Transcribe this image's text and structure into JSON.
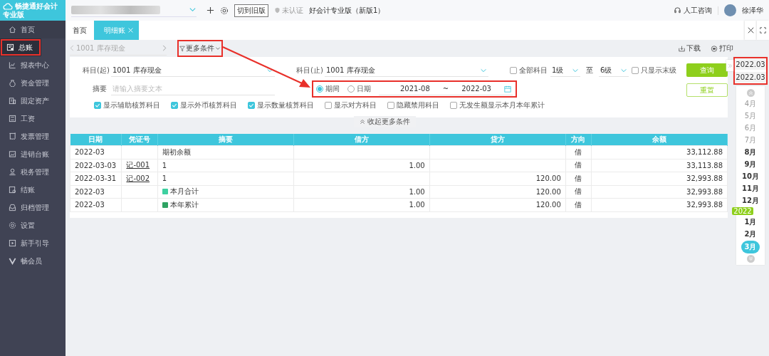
{
  "sidebar": {
    "logo": {
      "title": "畅捷通好会计",
      "edition": "专业版"
    },
    "items": [
      {
        "label": "首页",
        "selected": false,
        "highlighted": false
      },
      {
        "label": "总账",
        "selected": true,
        "highlighted": true
      },
      {
        "label": "报表中心",
        "selected": false,
        "highlighted": false
      },
      {
        "label": "资金管理",
        "selected": false,
        "highlighted": false
      },
      {
        "label": "固定资产",
        "selected": false,
        "highlighted": false
      },
      {
        "label": "工资",
        "selected": false,
        "highlighted": false
      },
      {
        "label": "发票管理",
        "selected": false,
        "highlighted": false
      },
      {
        "label": "进销台账",
        "selected": false,
        "highlighted": false
      },
      {
        "label": "税务管理",
        "selected": false,
        "highlighted": false
      },
      {
        "label": "结账",
        "selected": false,
        "highlighted": false
      },
      {
        "label": "归档管理",
        "selected": false,
        "highlighted": false
      },
      {
        "label": "设置",
        "selected": false,
        "highlighted": false
      },
      {
        "label": "新手引导",
        "selected": false,
        "highlighted": false
      },
      {
        "label": "畅会员",
        "selected": false,
        "highlighted": false
      }
    ]
  },
  "topbar": {
    "old_version_button": "切到旧版",
    "cert_status": "未认证",
    "product": "好会计专业版（新版1）",
    "support": "人工咨询",
    "user": "徐泽华"
  },
  "tabs": [
    {
      "label": "首页",
      "selected": false,
      "closable": false
    },
    {
      "label": "明细账",
      "selected": true,
      "closable": true
    }
  ],
  "toolbar": {
    "account_nav": "1001 库存现金",
    "more_conditions": {
      "label": "更多条件",
      "highlighted": true
    },
    "download": "下载",
    "print": "打印"
  },
  "filters": {
    "subject_from": {
      "label": "科目(起)",
      "value": "1001 库存现金"
    },
    "subject_to": {
      "label": "科目(止)",
      "value": "1001 库存现金"
    },
    "all_subjects": {
      "label": "全部科目",
      "checked": false
    },
    "level_from": "1级",
    "level_sep": "至",
    "level_to": "6级",
    "leaf_only": {
      "label": "只显示末级",
      "checked": false
    },
    "summary": {
      "label": "摘要",
      "placeholder": "请输入摘要文本"
    },
    "period_group": {
      "highlighted": true,
      "modes": [
        {
          "label": "期间",
          "selected": true
        },
        {
          "label": "日期",
          "selected": false
        }
      ],
      "start": "2021-08",
      "sep": "~",
      "end": "2022-03"
    },
    "options": [
      {
        "label": "显示辅助核算科目",
        "checked": true
      },
      {
        "label": "显示外币核算科目",
        "checked": true
      },
      {
        "label": "显示数量核算科目",
        "checked": true
      },
      {
        "label": "显示对方科目",
        "checked": false
      },
      {
        "label": "隐藏禁用科目",
        "checked": false
      },
      {
        "label": "无发生额显示本月本年累计",
        "checked": false
      }
    ],
    "query_button": "查询",
    "reset_button": "重置",
    "collapse_button": "收起更多条件"
  },
  "table": {
    "columns": [
      "日期",
      "凭证号",
      "摘要",
      "借方",
      "贷方",
      "方向",
      "余额"
    ],
    "rows": [
      {
        "kind": "entry",
        "date": "2022-03",
        "voucher": "",
        "summary": "期初余额",
        "debit": "",
        "credit": "",
        "direction": "借",
        "balance": "33,112.88"
      },
      {
        "kind": "entry",
        "date": "2022-03-03",
        "voucher": "记-001",
        "summary": "1",
        "debit": "1.00",
        "credit": "",
        "direction": "借",
        "balance": "33,113.88"
      },
      {
        "kind": "entry",
        "date": "2022-03-31",
        "voucher": "记-002",
        "summary": "1",
        "debit": "",
        "credit": "120.00",
        "direction": "借",
        "balance": "32,993.88"
      },
      {
        "kind": "month_total",
        "date": "2022-03",
        "voucher": "",
        "summary": "本月合计",
        "debit": "1.00",
        "credit": "120.00",
        "direction": "借",
        "balance": "32,993.88"
      },
      {
        "kind": "year_total",
        "date": "2022-03",
        "voucher": "",
        "summary": "本年累计",
        "debit": "1.00",
        "credit": "120.00",
        "direction": "借",
        "balance": "32,993.88"
      }
    ]
  },
  "period_panel": {
    "highlighted": true,
    "current": [
      "2022.03",
      "2022.03"
    ],
    "items": [
      {
        "kind": "month",
        "label": "4月",
        "has_data": false,
        "selected": false
      },
      {
        "kind": "month",
        "label": "5月",
        "has_data": false,
        "selected": false
      },
      {
        "kind": "month",
        "label": "6月",
        "has_data": false,
        "selected": false
      },
      {
        "kind": "month",
        "label": "7月",
        "has_data": false,
        "selected": false
      },
      {
        "kind": "month",
        "label": "8月",
        "has_data": true,
        "selected": false
      },
      {
        "kind": "month",
        "label": "9月",
        "has_data": true,
        "selected": false
      },
      {
        "kind": "month",
        "label": "10月",
        "has_data": true,
        "selected": false
      },
      {
        "kind": "month",
        "label": "11月",
        "has_data": true,
        "selected": false
      },
      {
        "kind": "month",
        "label": "12月",
        "has_data": true,
        "selected": false
      },
      {
        "kind": "year",
        "label": "2022"
      },
      {
        "kind": "month",
        "label": "1月",
        "has_data": true,
        "selected": false
      },
      {
        "kind": "month",
        "label": "2月",
        "has_data": true,
        "selected": false
      },
      {
        "kind": "month",
        "label": "3月",
        "has_data": true,
        "selected": true
      }
    ]
  }
}
